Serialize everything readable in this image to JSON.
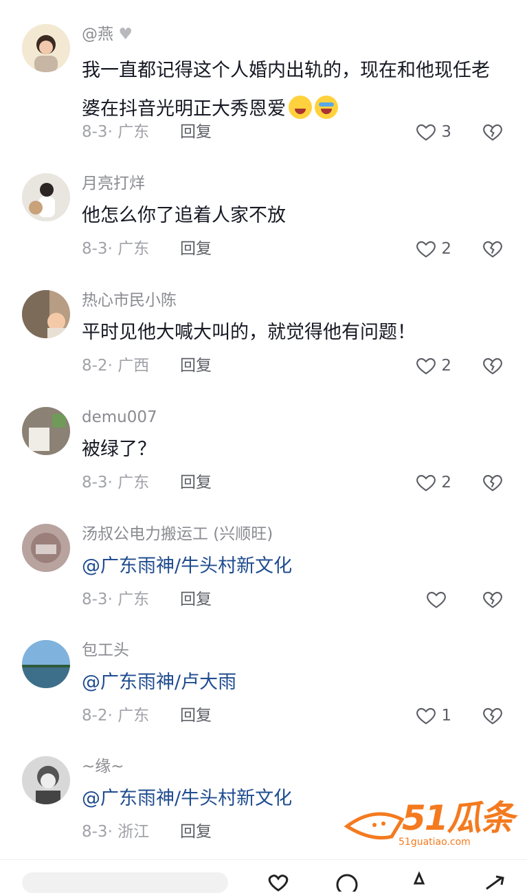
{
  "comments": [
    {
      "name": "@燕",
      "text": "我一直都记得这个人婚内出轨的，现在和他现任老婆在抖音光明正大秀恩爱",
      "date": "8-3",
      "location": "广东",
      "reply": "回复",
      "likes": "3"
    },
    {
      "name": "月亮打烊",
      "text": "他怎么你了追着人家不放",
      "date": "8-3",
      "location": "广东",
      "reply": "回复",
      "likes": "2"
    },
    {
      "name": "热心市民小陈",
      "text": "平时见他大喊大叫的，就觉得他有问题！",
      "date": "8-2",
      "location": "广西",
      "reply": "回复",
      "likes": "2"
    },
    {
      "name": "demu007",
      "text": "被绿了？",
      "date": "8-3",
      "location": "广东",
      "reply": "回复",
      "likes": "2"
    },
    {
      "name": "汤叔公电力搬运工 (兴顺旺)",
      "text": "@广东雨神/牛头村新文化",
      "date": "8-3",
      "location": "广东",
      "reply": "回复",
      "likes": ""
    },
    {
      "name": "包工头",
      "text": "@广东雨神/卢大雨",
      "date": "8-2",
      "location": "广东",
      "reply": "回复",
      "likes": "1"
    },
    {
      "name": "~缘~",
      "text": "@广东雨神/牛头村新文化",
      "date": "8-3",
      "location": "浙江",
      "reply": "回复",
      "likes": ""
    }
  ],
  "watermark": {
    "brand": "51瓜条",
    "url": "51guatiao.com"
  },
  "colors": {
    "mention": "#1f4c8f",
    "meta": "#a0a2a8",
    "accent": "#f47a1f"
  }
}
